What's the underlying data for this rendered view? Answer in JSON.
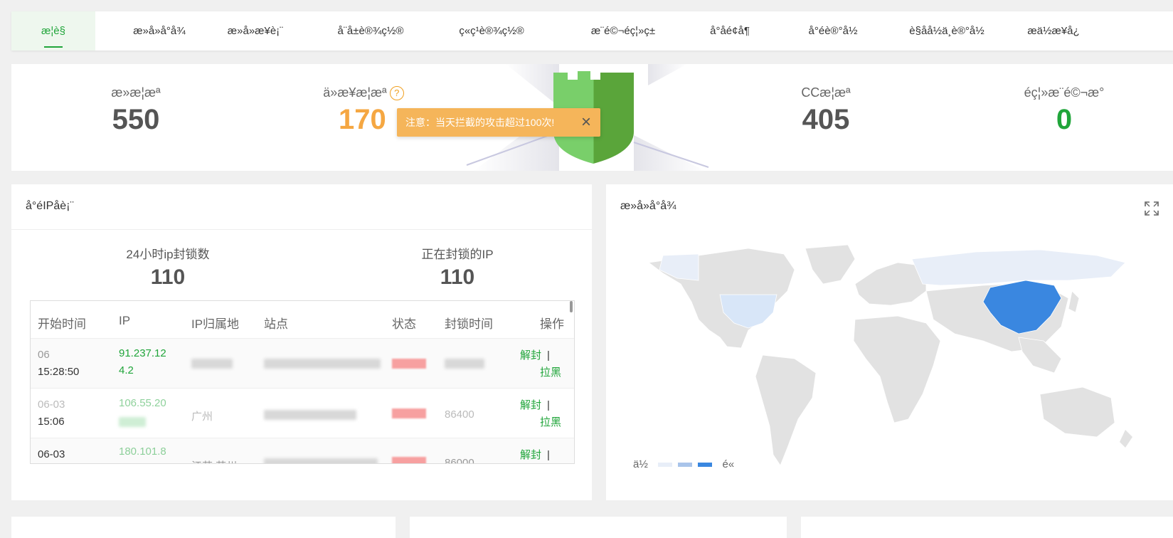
{
  "tabs": [
    {
      "label": "æ¦è§",
      "active": true
    },
    {
      "label": "æ»å»å°å¾"
    },
    {
      "label": "æ»å»æ¥è¡¨"
    },
    {
      "label": "å¨å±è®¾ç½®"
    },
    {
      "label": "ç«ç¹è®¾ç½®"
    },
    {
      "label": "æ¨é©¬éç¦»ç±"
    },
    {
      "label": "å°åé¢å¶"
    },
    {
      "label": "å°éè®°å½"
    },
    {
      "label": "è§åå½ä¸è®°å½"
    },
    {
      "label": "æä½æ¥å¿"
    }
  ],
  "stats": {
    "total_label": "æ»æ¦æª",
    "total_value": "550",
    "today_label": "ä»æ¥æ¦æª",
    "today_value": "170",
    "cc_label": "CCæ¦æª",
    "cc_value": "405",
    "trojan_label": "éç¦»æ¨é©¬æ°",
    "trojan_value": "0",
    "help_icon": "?"
  },
  "tooltip": {
    "text": "注意：当天拦截的攻击超过100次!",
    "close_icon": "×"
  },
  "ip_card": {
    "title": "å°éIPåè¡¨",
    "blocked_24h_label": "24小时ip封锁数",
    "blocked_24h_value": "110",
    "blocking_now_label": "正在封锁的IP",
    "blocking_now_value": "110",
    "columns": [
      "开始时间",
      "IP",
      "IP归属地",
      "站点",
      "状态",
      "封锁时间",
      "操作"
    ],
    "rows": [
      {
        "time_line1": "06",
        "time_line2": "15:28:50",
        "ip_line1": "91.237.12",
        "ip_line2": "4.2",
        "unblock": "解封",
        "sep": "|",
        "blacklist": "拉黑"
      },
      {
        "time_line1": "06-03",
        "time_line2": "15:06",
        "ip_line1": "106.55.20",
        "loc": "广州",
        "block_time": "86400",
        "unblock": "解封",
        "sep": "|",
        "blacklist": "拉黑"
      },
      {
        "time_line1": "06-03",
        "ip_line1": "180.101.8",
        "loc": "江苏 苏州",
        "block_time": "86000",
        "unblock": "解封",
        "sep": "|"
      }
    ]
  },
  "map_card": {
    "title": "æ»å»å°å¾",
    "expand_icon": "expand-icon",
    "legend_low": "ä½",
    "legend_high": "é«",
    "colors": {
      "low": "#e8eef8",
      "mid": "#a9c4ea",
      "high": "#3a87e0",
      "land": "#e2e2e2"
    }
  },
  "colors": {
    "accent": "#20a53a",
    "warning": "#f5b55a",
    "today": "#f5a742"
  }
}
